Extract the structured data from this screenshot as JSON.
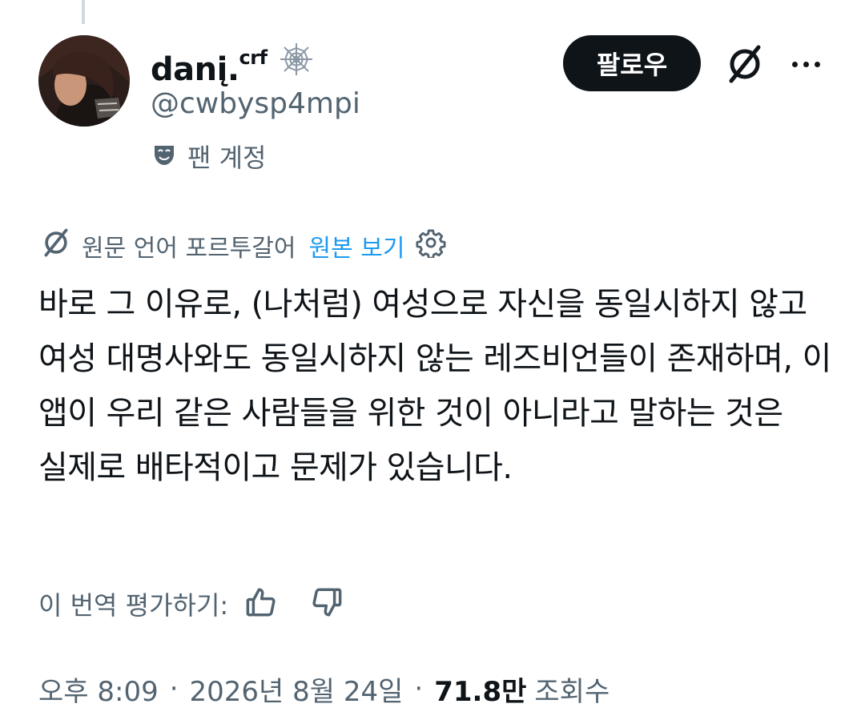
{
  "author": {
    "display_name": "danį.",
    "display_name_sup": "crf",
    "handle": "@cwbysp4mpi",
    "badge": "spider-web-icon",
    "account_label": "팬 계정",
    "account_icon": "theater-mask-icon"
  },
  "actions": {
    "follow_label": "팔로우",
    "grok_icon": "grok-icon",
    "more_icon": "more-icon"
  },
  "translation": {
    "label": "원문 언어 포르투갈어",
    "show_original": "원본 보기",
    "icon": "grok-icon",
    "settings_icon": "gear-icon"
  },
  "tweet": {
    "text": "바로 그 이유로, (나처럼) 여성으로 자신을 동일시하지 않고 여성 대명사와도 동일시하지 않는 레즈비언들이 존재하며, 이 앱이 우리 같은 사람들을 위한 것이 아니라고 말하는 것은 실제로 배타적이고 문제가 있습니다."
  },
  "rating": {
    "label": "이 번역 평가하기:",
    "up_icon": "thumbs-up-icon",
    "down_icon": "thumbs-down-icon"
  },
  "meta": {
    "time": "오후 8:09",
    "separator": "·",
    "date": "2026년 8월 24일",
    "views_count": "71.8만",
    "views_label": "조회수"
  },
  "colors": {
    "text": "#0f1419",
    "secondary": "#536471",
    "link": "#1d9bf0",
    "button": "#0f1419"
  }
}
